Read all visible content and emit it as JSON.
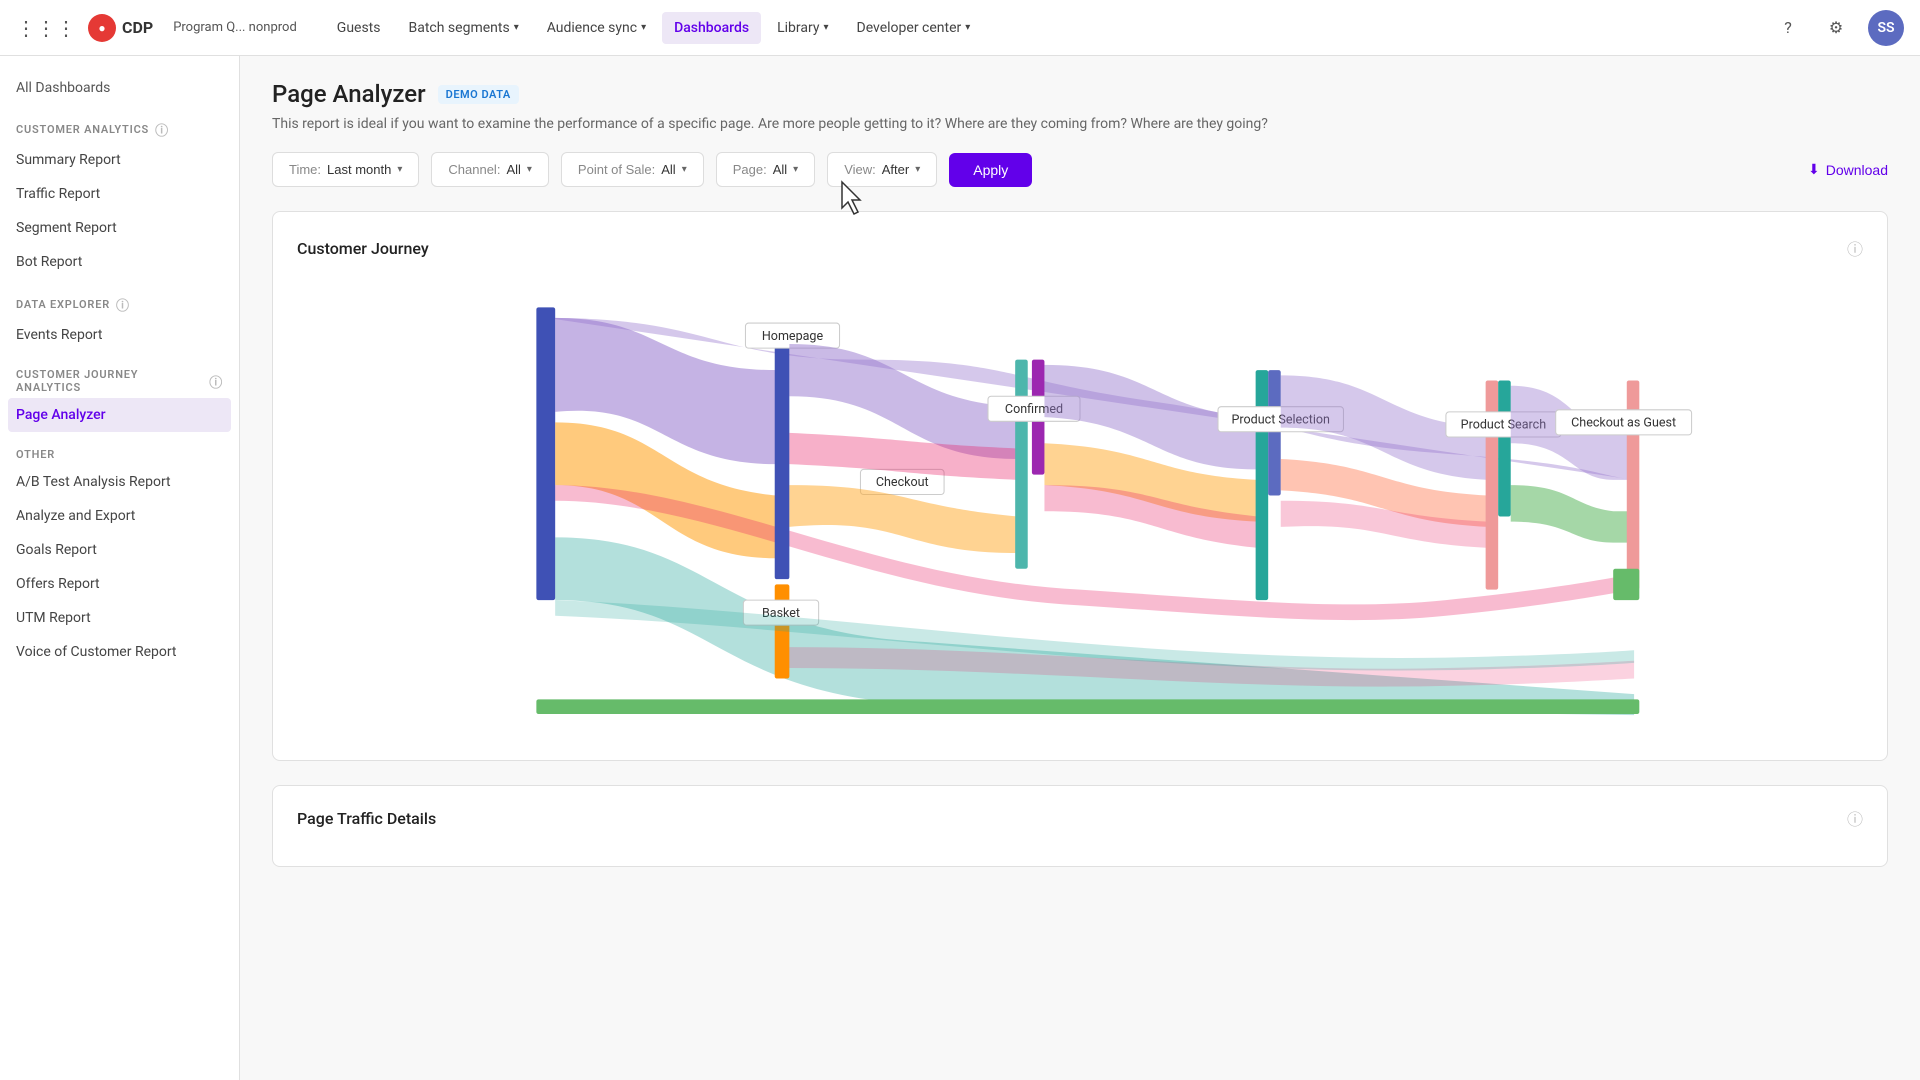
{
  "app": {
    "logo_text": "CDP",
    "program_name": "Program Q... nonprod"
  },
  "nav": {
    "items": [
      {
        "label": "Guests",
        "active": false,
        "has_chevron": false
      },
      {
        "label": "Batch segments",
        "active": false,
        "has_chevron": true
      },
      {
        "label": "Audience sync",
        "active": false,
        "has_chevron": true
      },
      {
        "label": "Dashboards",
        "active": true,
        "has_chevron": false
      },
      {
        "label": "Library",
        "active": false,
        "has_chevron": true
      },
      {
        "label": "Developer center",
        "active": false,
        "has_chevron": true
      }
    ],
    "user_initials": "SS"
  },
  "sidebar": {
    "all_dashboards_label": "All Dashboards",
    "sections": [
      {
        "title": "CUSTOMER ANALYTICS",
        "items": [
          {
            "label": "Summary Report",
            "active": false
          },
          {
            "label": "Traffic Report",
            "active": false
          },
          {
            "label": "Segment Report",
            "active": false
          },
          {
            "label": "Bot Report",
            "active": false
          }
        ]
      },
      {
        "title": "DATA EXPLORER",
        "items": [
          {
            "label": "Events Report",
            "active": false
          }
        ]
      },
      {
        "title": "CUSTOMER JOURNEY ANALYTICS",
        "items": [
          {
            "label": "Page Analyzer",
            "active": true
          }
        ]
      },
      {
        "title": "OTHER",
        "items": [
          {
            "label": "A/B Test Analysis Report",
            "active": false
          },
          {
            "label": "Analyze and Export",
            "active": false
          },
          {
            "label": "Goals Report",
            "active": false
          },
          {
            "label": "Offers Report",
            "active": false
          },
          {
            "label": "UTM Report",
            "active": false
          },
          {
            "label": "Voice of Customer Report",
            "active": false
          }
        ]
      }
    ]
  },
  "page": {
    "title": "Page Analyzer",
    "demo_badge": "DEMO DATA",
    "description": "This report is ideal if you want to examine the performance of a specific page. Are more people getting to it? Where are they coming from? Where are they going?"
  },
  "filters": {
    "time": {
      "label": "Time:",
      "value": "Last month"
    },
    "channel": {
      "label": "Channel:",
      "value": "All"
    },
    "point_of_sale": {
      "label": "Point of Sale:",
      "value": "All"
    },
    "page": {
      "label": "Page:",
      "value": "All"
    },
    "view": {
      "label": "View:",
      "value": "After"
    },
    "apply_label": "Apply",
    "download_label": "Download"
  },
  "customer_journey": {
    "title": "Customer Journey",
    "nodes": [
      {
        "id": "checkout",
        "label": "Checkout"
      },
      {
        "id": "homepage",
        "label": "Homepage"
      },
      {
        "id": "basket",
        "label": "Basket"
      },
      {
        "id": "confirmed",
        "label": "Confirmed"
      },
      {
        "id": "product_selection",
        "label": "Product Selection"
      },
      {
        "id": "product_search",
        "label": "Product Search"
      },
      {
        "id": "checkout_guest",
        "label": "Checkout as Guest"
      }
    ]
  },
  "page_traffic": {
    "title": "Page Traffic Details"
  }
}
